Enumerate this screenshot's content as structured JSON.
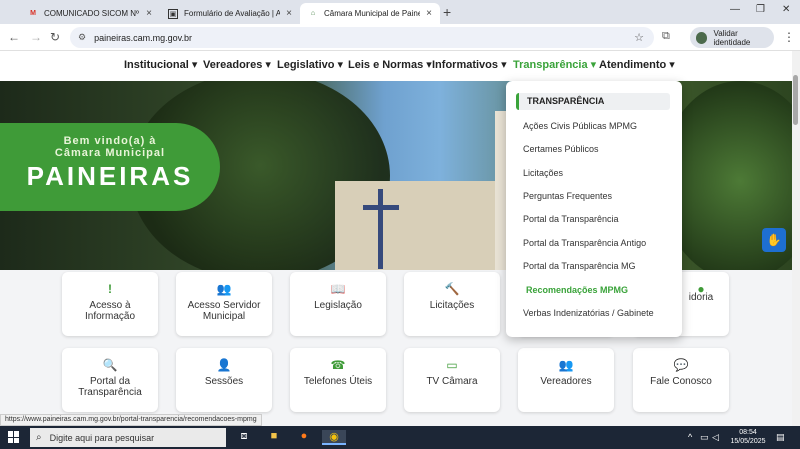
{
  "browser": {
    "tabs": [
      {
        "label": "COMUNICADO SICOM Nº 13/20",
        "favicon": "M",
        "favicon_color": "#d93025",
        "active": false
      },
      {
        "label": "Formulário de Avaliação | Avalia",
        "favicon": "▣",
        "favicon_color": "#333333",
        "active": false
      },
      {
        "label": "Câmara Municipal de Paineiras",
        "favicon": "⌂",
        "favicon_color": "#3a7a3a",
        "active": true
      }
    ],
    "address": "paineiras.cam.mg.gov.br",
    "identity_label": "Validar identidade"
  },
  "site": {
    "menu": [
      {
        "label": "Institucional ▾",
        "active": false
      },
      {
        "label": "Vereadores ▾",
        "active": false
      },
      {
        "label": "Legislativo ▾",
        "active": false
      },
      {
        "label": "Leis e Normas ▾",
        "active": false
      },
      {
        "label": "Informativos ▾",
        "active": false
      },
      {
        "label": "Transparência ▾",
        "active": true
      },
      {
        "label": "Atendimento ▾",
        "active": false
      }
    ],
    "hero": {
      "line1": "Bem vindo(a) à",
      "line2": "Câmara Municipal",
      "line3": "PAINEIRAS"
    },
    "dropdown": {
      "heading": "TRANSPARÊNCIA",
      "items": [
        {
          "label": "Ações Civis Públicas MPMG",
          "selected": false
        },
        {
          "label": "Certames Públicos",
          "selected": false
        },
        {
          "label": "Licitações",
          "selected": false
        },
        {
          "label": "Perguntas Frequentes",
          "selected": false
        },
        {
          "label": "Portal da Transparência",
          "selected": false
        },
        {
          "label": "Portal da Transparência Antigo",
          "selected": false
        },
        {
          "label": "Portal da Transparência MG",
          "selected": false
        },
        {
          "label": "Recomendações MPMG",
          "selected": true
        },
        {
          "label": "Verbas Indenizatórias / Gabinete",
          "selected": false
        }
      ]
    },
    "cards": [
      {
        "label": "Acesso à Informação",
        "icon": "!"
      },
      {
        "label": "Acesso Servidor Municipal",
        "icon": "👥"
      },
      {
        "label": "Legislação",
        "icon": "📖"
      },
      {
        "label": "Licitações",
        "icon": "🔨"
      },
      {
        "label": "",
        "icon": ""
      },
      {
        "label": "idoria",
        "icon": "●"
      },
      {
        "label": "Portal da Transparência",
        "icon": "🔍"
      },
      {
        "label": "Sessões",
        "icon": "👤"
      },
      {
        "label": "Telefones Úteis",
        "icon": "☎"
      },
      {
        "label": "TV Câmara",
        "icon": "▭"
      },
      {
        "label": "Vereadores",
        "icon": "👥"
      },
      {
        "label": "Fale Conosco",
        "icon": "💬"
      }
    ],
    "accent_color": "#3f9b38"
  },
  "status_url": "https://www.paineiras.cam.mg.gov.br/portal-transparencia/recomendacoes-mpmg",
  "taskbar": {
    "search_placeholder": "Digite aqui para pesquisar",
    "time": "08:54",
    "date": "15/05/2025"
  }
}
